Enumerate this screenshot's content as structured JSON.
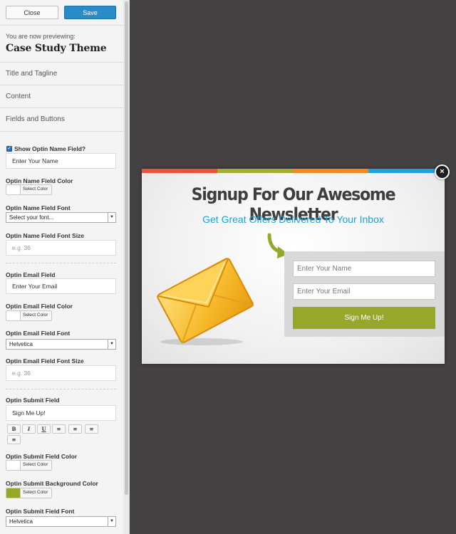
{
  "toolbar": {
    "close_label": "Close",
    "save_label": "Save"
  },
  "preview": {
    "intro": "You are now previewing:",
    "theme_name": "Case Study Theme"
  },
  "sections": [
    {
      "label": "Title and Tagline"
    },
    {
      "label": "Content"
    },
    {
      "label": "Fields and Buttons"
    }
  ],
  "fields": {
    "show_name": {
      "label": "Show Optin Name Field?",
      "checked": true
    },
    "name_value": "Enter Your Name",
    "name_color_label": "Optin Name Field Color",
    "name_font_label": "Optin Name Field Font",
    "name_font_value": "Select your font...",
    "name_size_label": "Optin Name Field Font Size",
    "name_size_placeholder": "e.g. 36",
    "email_label": "Optin Email Field",
    "email_value": "Enter Your Email",
    "email_color_label": "Optin Email Field Color",
    "email_font_label": "Optin Email Field Font",
    "email_font_value": "Helvetica",
    "email_size_label": "Optin Email Field Font Size",
    "email_size_placeholder": "e.g. 36",
    "submit_label": "Optin Submit Field",
    "submit_value": "Sign Me Up!",
    "submit_color_label": "Optin Submit Field Color",
    "submit_bg_label": "Optin Submit Background Color",
    "submit_font_label": "Optin Submit Field Font",
    "submit_font_value": "Helvetica",
    "select_color_label": "Select Color"
  },
  "format_buttons": [
    "B",
    "I",
    "U",
    "≡",
    "≡",
    "≡",
    "≡"
  ],
  "colors": {
    "save_button": "#2a8bc9",
    "submit_swatch": "#97a72c",
    "white_swatch": "#ffffff",
    "popup_title": "#3e3e3e",
    "popup_subtitle": "#1ba3dd",
    "stripe_red": "#e8533a",
    "stripe_olive": "#a4ae32",
    "stripe_orange": "#f08a24",
    "stripe_blue": "#1ea1dd"
  },
  "popup": {
    "title": "Signup For Our Awesome Newsletter",
    "subtitle": "Get Great Offers Delivered To Your Inbox",
    "name_placeholder": "Enter Your Name",
    "email_placeholder": "Enter Your Email",
    "submit_label": "Sign Me Up!",
    "close_glyph": "×",
    "envelope_icon": "envelope-icon",
    "arrow_icon": "curved-arrow-icon"
  }
}
